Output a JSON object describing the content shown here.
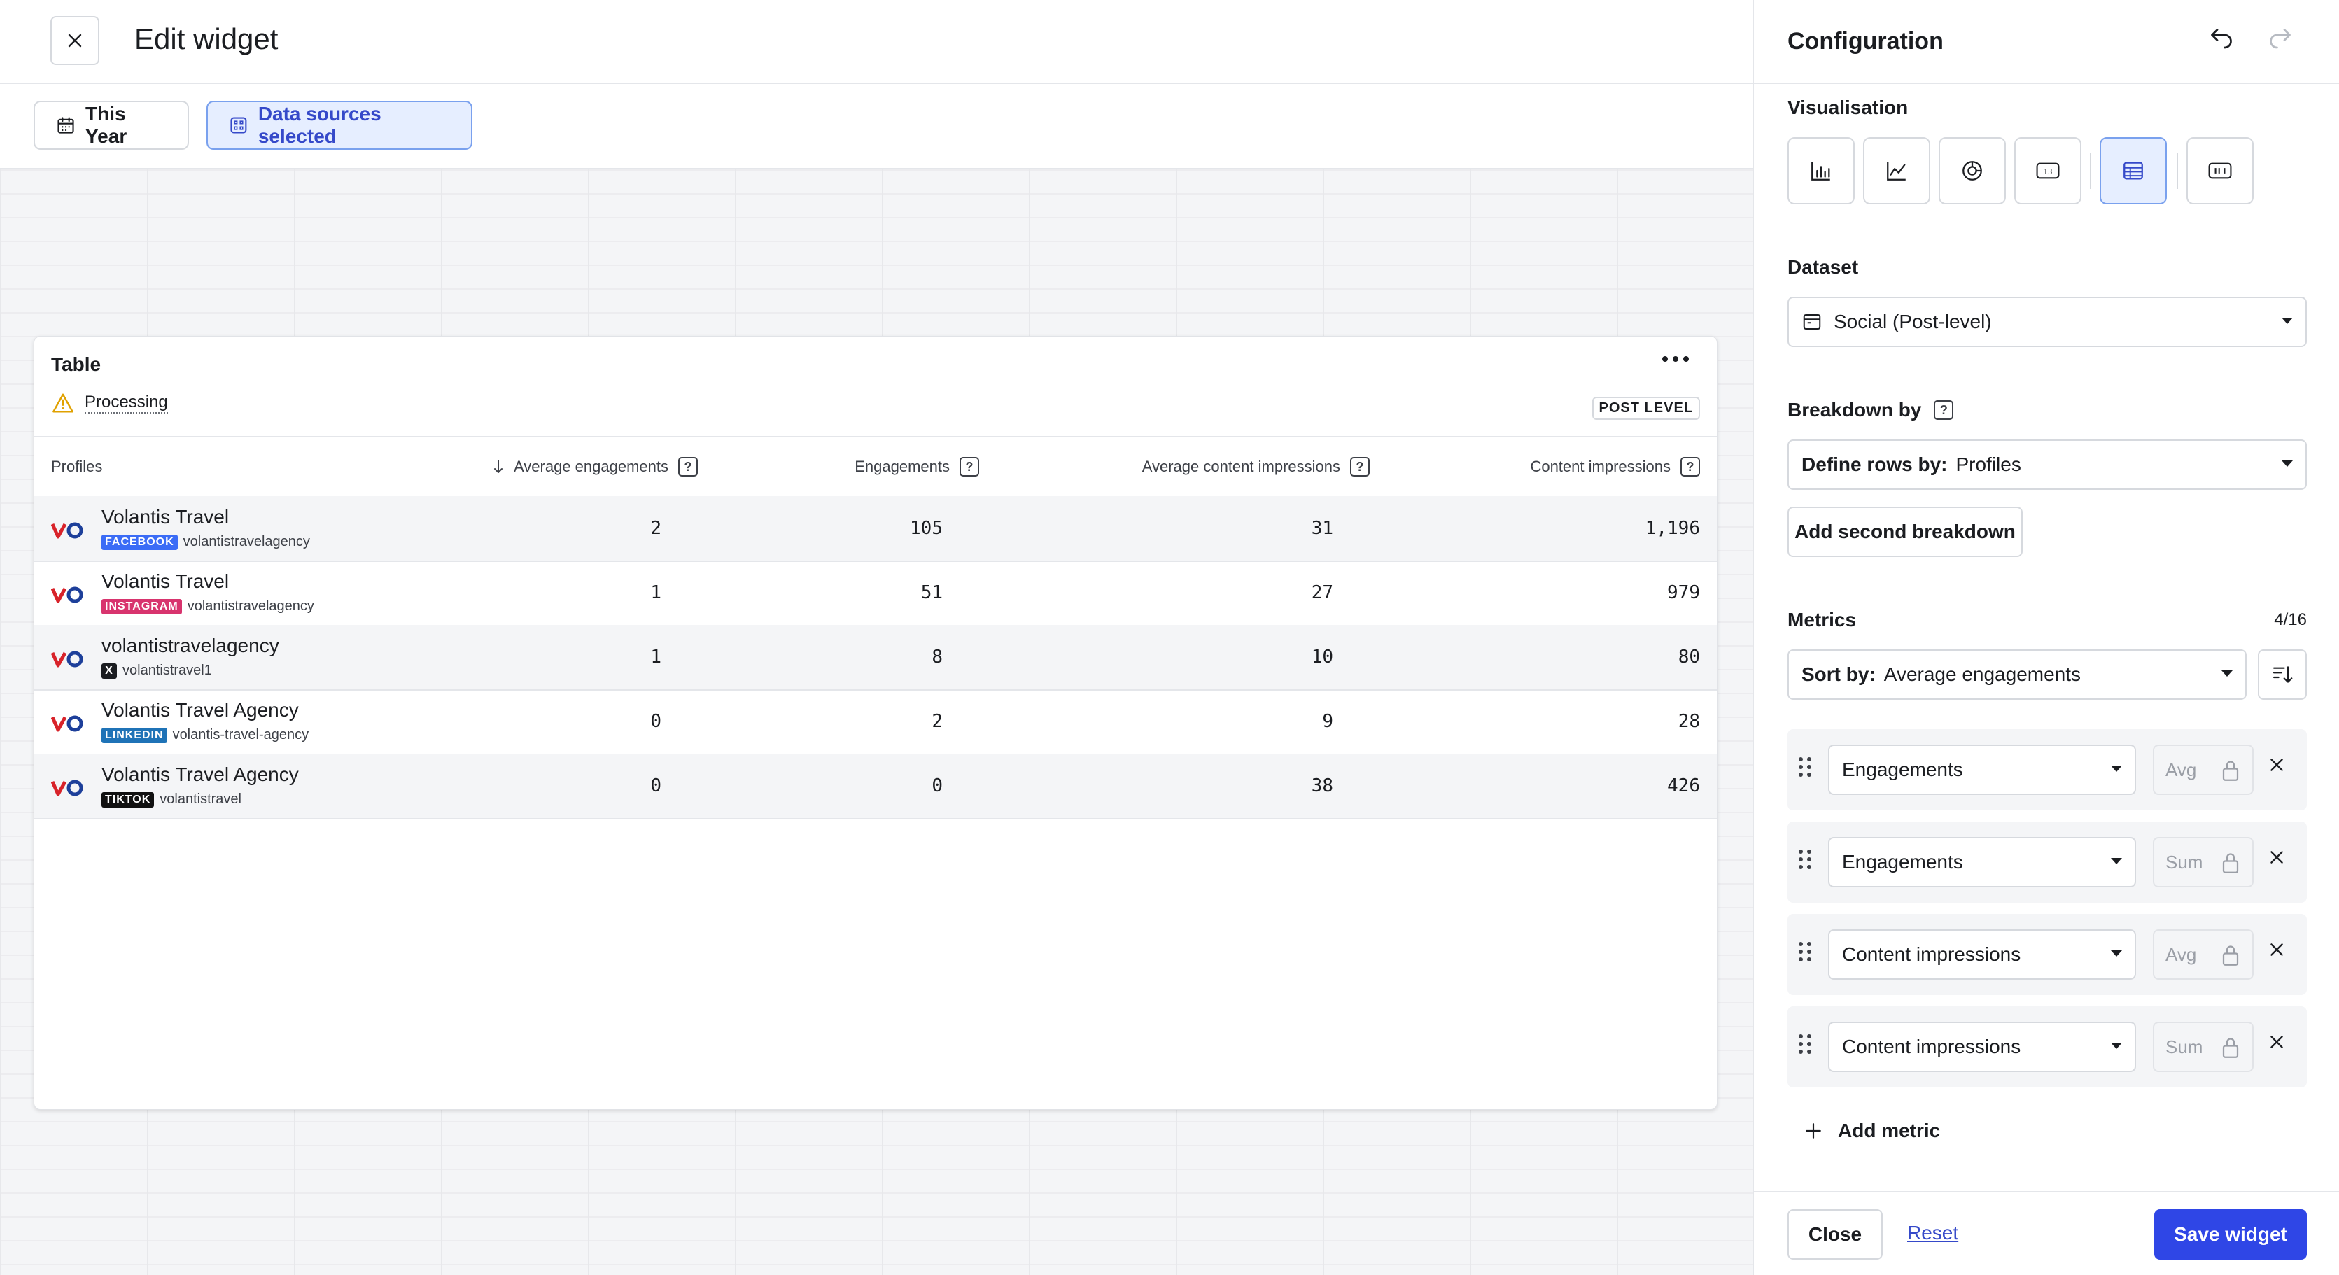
{
  "header": {
    "title": "Edit widget"
  },
  "filters": {
    "date": "This Year",
    "sources": "Data sources selected"
  },
  "widget": {
    "title": "Table",
    "status": "Processing",
    "level_badge": "POST LEVEL",
    "columns": [
      "Profiles",
      "Average engagements",
      "Engagements",
      "Average content impressions",
      "Content impressions"
    ],
    "rows": [
      {
        "name": "Volantis Travel",
        "network": "FACEBOOK",
        "network_color": "#3b6cf6",
        "handle": "volantistravelagency",
        "values": [
          "2",
          "105",
          "31",
          "1,196"
        ]
      },
      {
        "name": "Volantis Travel",
        "network": "INSTAGRAM",
        "network_color": "#d8346e",
        "handle": "volantistravelagency",
        "values": [
          "1",
          "51",
          "27",
          "979"
        ]
      },
      {
        "name": "volantistravelagency",
        "network": "X",
        "network_color": "#1b1d21",
        "handle": "volantistravel1",
        "values": [
          "1",
          "8",
          "10",
          "80"
        ]
      },
      {
        "name": "Volantis Travel Agency",
        "network": "LINKEDIN",
        "network_color": "#1f73b7",
        "handle": "volantis-travel-agency",
        "values": [
          "0",
          "2",
          "9",
          "28"
        ]
      },
      {
        "name": "Volantis Travel Agency",
        "network": "TIKTOK",
        "network_color": "#111111",
        "handle": "volantistravel",
        "values": [
          "0",
          "0",
          "38",
          "426"
        ]
      }
    ]
  },
  "panel": {
    "title": "Configuration",
    "visualisation_label": "Visualisation",
    "dataset_label": "Dataset",
    "dataset_value": "Social (Post-level)",
    "breakdown_label": "Breakdown by",
    "rows_prefix": "Define rows by:",
    "rows_value": "Profiles",
    "add_breakdown": "Add second breakdown",
    "metrics_label": "Metrics",
    "metrics_count": "4/16",
    "sort_prefix": "Sort by:",
    "sort_value": "Average engagements",
    "metrics": [
      {
        "metric": "Engagements",
        "agg": "Avg"
      },
      {
        "metric": "Engagements",
        "agg": "Sum"
      },
      {
        "metric": "Content impressions",
        "agg": "Avg"
      },
      {
        "metric": "Content impressions",
        "agg": "Sum"
      }
    ],
    "add_metric": "Add metric",
    "close": "Close",
    "reset": "Reset",
    "save": "Save widget"
  },
  "colors": {
    "accent": "#2f46e6",
    "accent_soft": "#e6eeff",
    "warning": "#e0a100",
    "brand_red": "#d8232a",
    "brand_blue": "#1d3f9a"
  }
}
